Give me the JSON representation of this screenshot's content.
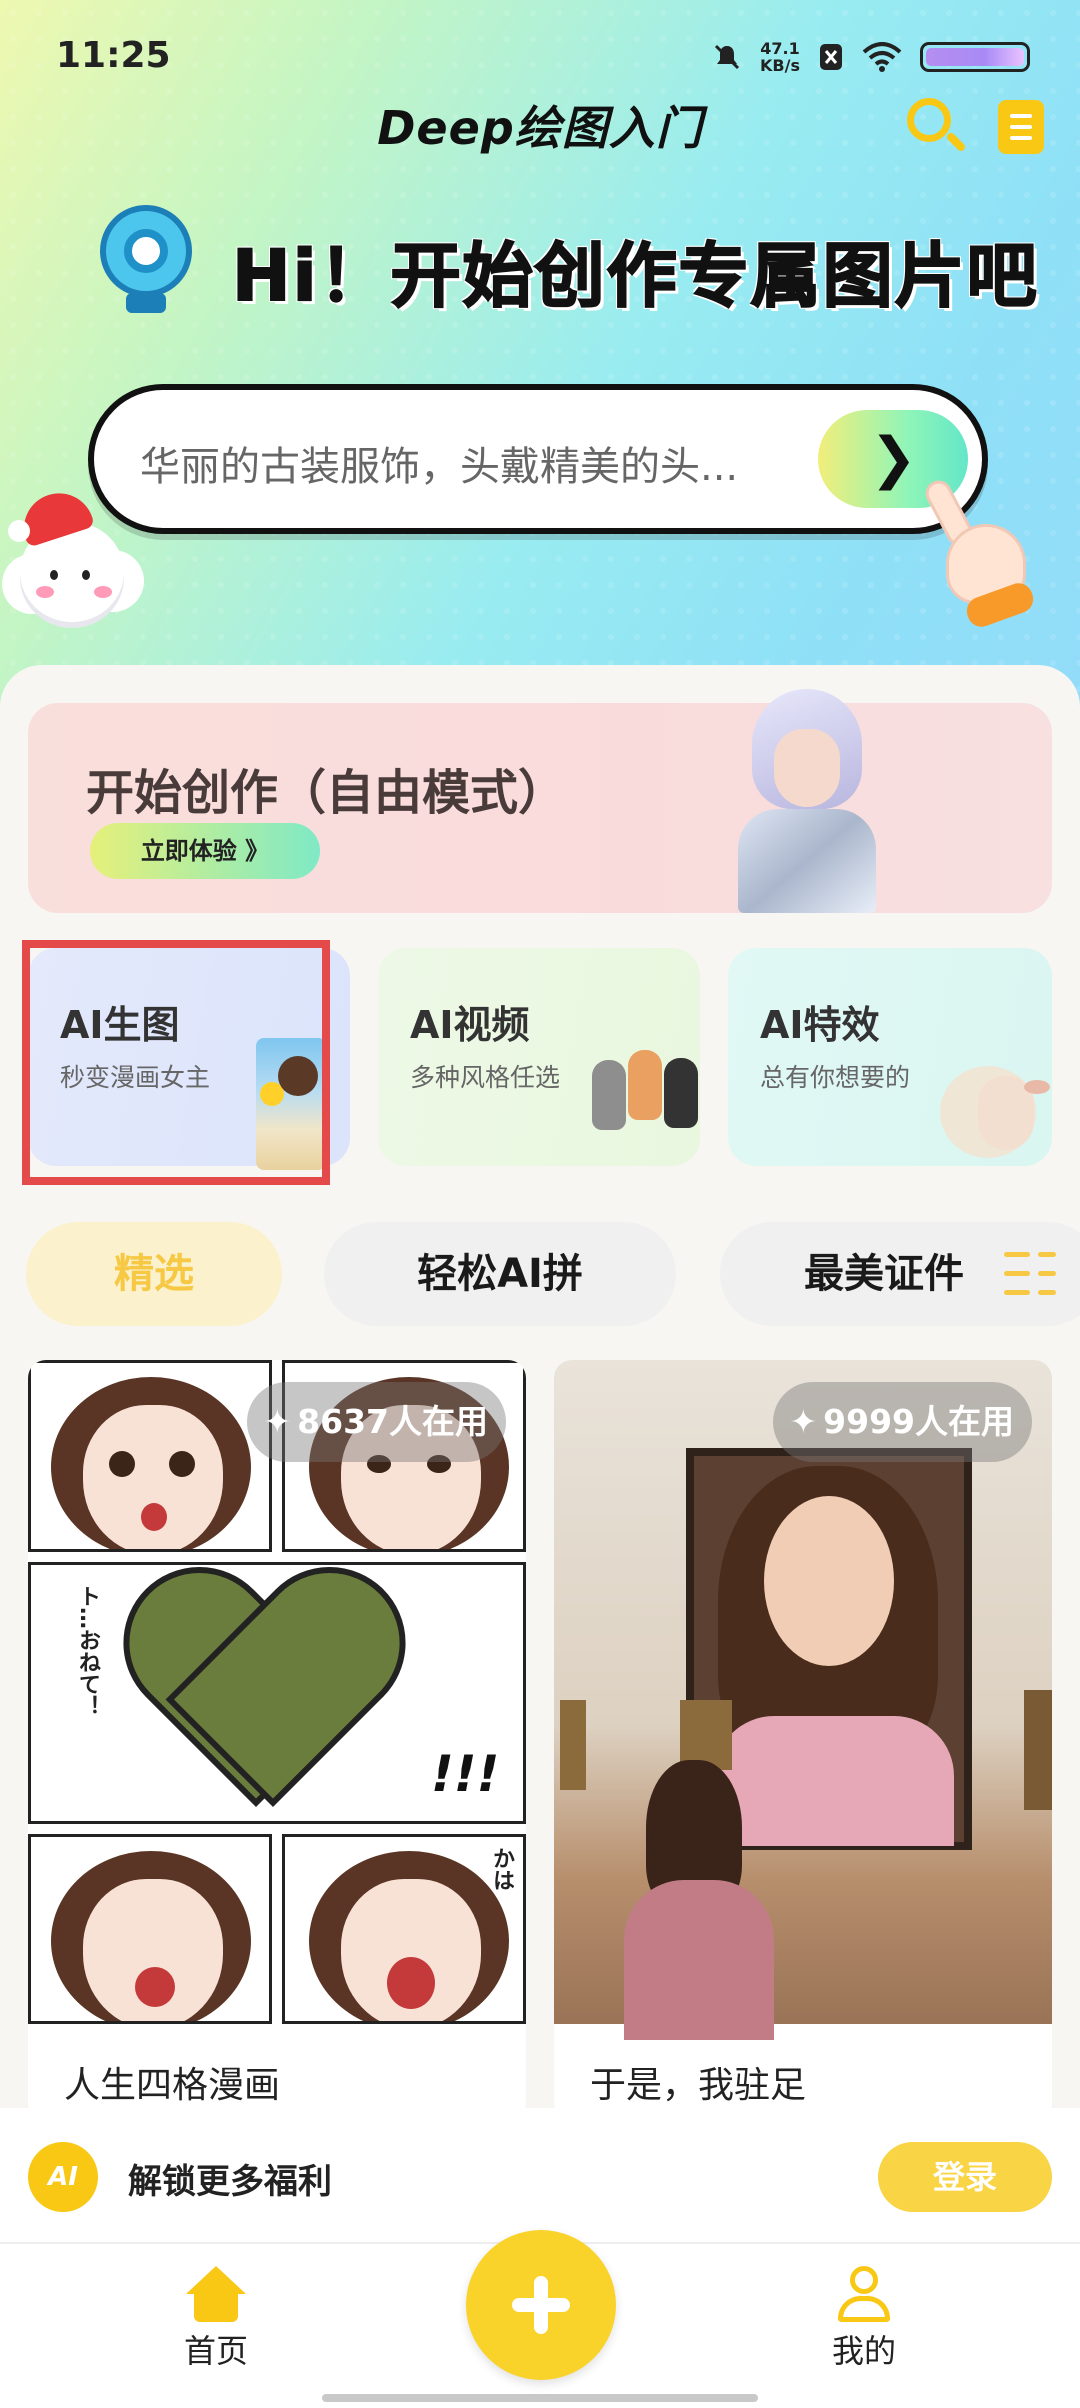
{
  "status_bar": {
    "time": "11:25",
    "net_speed_value": "47.1",
    "net_speed_unit": "KB/s"
  },
  "header": {
    "app_title": "Deep绘图入门",
    "search_icon": "search-icon",
    "doc_icon": "document-icon"
  },
  "hero": {
    "greeting": "Hi！开始创作专属图片吧",
    "search_placeholder": "华丽的古装服饰，头戴精美的头...",
    "go_icon": "chevron-right-icon"
  },
  "free_create": {
    "title": "开始创作（自由模式）",
    "cta": "立即体验 》"
  },
  "tools": [
    {
      "title": "AI生图",
      "subtitle": "秒变漫画女主"
    },
    {
      "title": "AI视频",
      "subtitle": "多种风格任选"
    },
    {
      "title": "AI特效",
      "subtitle": "总有你想要的"
    }
  ],
  "tabs": [
    {
      "label": "精选"
    },
    {
      "label": "轻松AI拼"
    },
    {
      "label": "最美证件"
    }
  ],
  "feed": [
    {
      "usage": "8637人在用",
      "label": "人生四格漫画"
    },
    {
      "usage": "9999人在用",
      "label": "于是，我驻足"
    }
  ],
  "comic_text": {
    "exclaim": "!!!",
    "bubble1": "ト…おねて！",
    "bubble2": "かは"
  },
  "unlock_bar": {
    "logo_text": "AI",
    "text": "解锁更多福利",
    "login": "登录"
  },
  "bottom_nav": {
    "home": "首页",
    "mine": "我的"
  },
  "colors": {
    "accent_yellow": "#f9c814",
    "highlight_red": "#e54a4a"
  }
}
